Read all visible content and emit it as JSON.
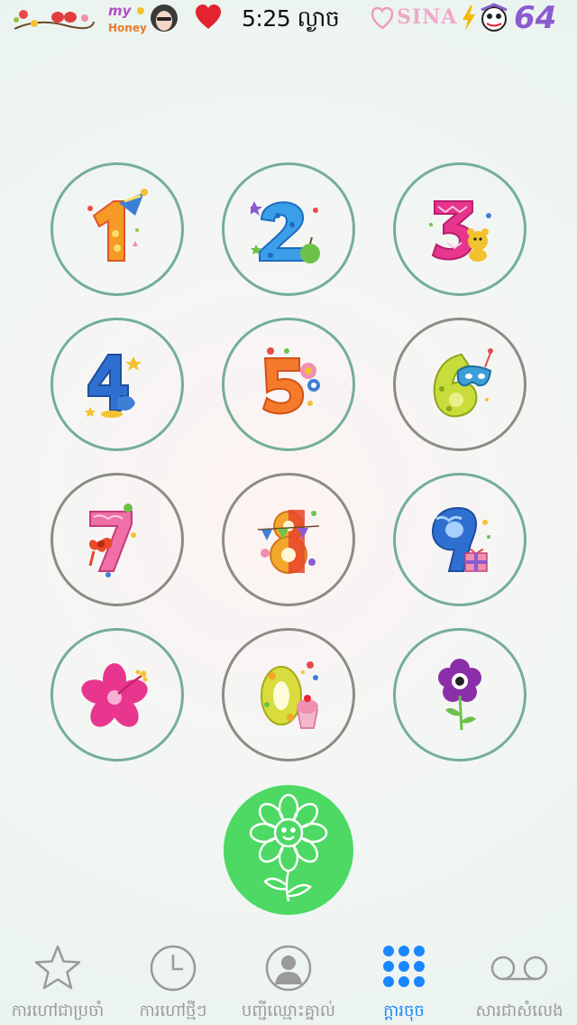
{
  "status_bar": {
    "badge_text": "my Honey",
    "time": "5:25 ល្ងាច",
    "carrier": "SINA",
    "battery": "64"
  },
  "keypad": {
    "keys": [
      {
        "digit": "1",
        "icon": "number-1-party-hat-icon"
      },
      {
        "digit": "2",
        "icon": "number-2-apple-icon"
      },
      {
        "digit": "3",
        "icon": "number-3-teddy-bear-icon"
      },
      {
        "digit": "4",
        "icon": "number-4-icon"
      },
      {
        "digit": "5",
        "icon": "number-5-flowers-icon"
      },
      {
        "digit": "6",
        "icon": "number-6-mask-icon"
      },
      {
        "digit": "7",
        "icon": "number-7-bow-icon"
      },
      {
        "digit": "8",
        "icon": "number-8-bunting-icon"
      },
      {
        "digit": "9",
        "icon": "number-9-gift-icon"
      },
      {
        "digit": "*",
        "icon": "hibiscus-flower-icon"
      },
      {
        "digit": "0",
        "icon": "number-0-cupcake-icon"
      },
      {
        "digit": "#",
        "icon": "purple-flower-icon"
      }
    ],
    "call_icon": "smiling-flower-icon"
  },
  "tabs": [
    {
      "label": "ការហៅជាប្រចាំ",
      "icon": "star-icon",
      "active": false
    },
    {
      "label": "ការហៅថ្មីៗ",
      "icon": "clock-icon",
      "active": false
    },
    {
      "label": "បញ្ជីឈ្មោះគ្នាល់",
      "icon": "contact-icon",
      "active": false
    },
    {
      "label": "ក្ដារចុច",
      "icon": "keypad-icon",
      "active": true
    },
    {
      "label": "សារជាសំលេង",
      "icon": "voicemail-icon",
      "active": false
    }
  ],
  "colors": {
    "ring_green": "#74ae98",
    "ring_gray": "#8b8c86",
    "call_green": "#4dd964",
    "active_tab": "#1a86ff",
    "inactive_tab": "#9a9a9a"
  }
}
